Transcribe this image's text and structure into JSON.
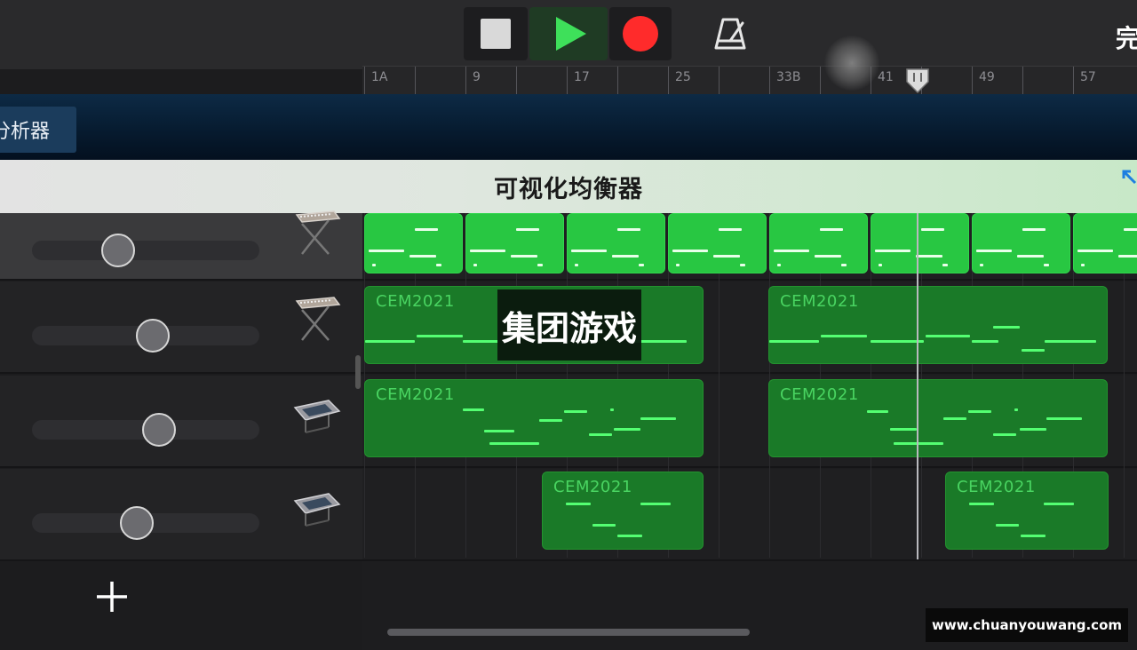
{
  "transport": {
    "stop_icon": "stop-icon",
    "play_icon": "play-icon",
    "record_icon": "record-icon",
    "metronome_icon": "metronome-icon",
    "done_label": "完成",
    "colors": {
      "play": "#3ee05a",
      "record": "#ff2b2b"
    }
  },
  "ruler": {
    "bars": [
      "1A",
      "9",
      "17",
      "25",
      "33B",
      "41",
      "49",
      "57"
    ]
  },
  "analyzer": {
    "tab_label": "分析器"
  },
  "eq": {
    "title": "可视化均衡器",
    "expand_icon": "expand-icon"
  },
  "tracks": [
    {
      "instrument_icon": "synth-keyboard-icon",
      "selected": true,
      "volume": 0.38
    },
    {
      "instrument_icon": "synth-keyboard-icon",
      "selected": false,
      "volume": 0.53
    },
    {
      "instrument_icon": "drum-machine-icon",
      "selected": false,
      "volume": 0.56
    },
    {
      "instrument_icon": "drum-machine-icon",
      "selected": false,
      "volume": 0.46
    }
  ],
  "regions": {
    "name": "CEM2021"
  },
  "add_track_icon": "plus-icon",
  "overlay": {
    "text": "集团游戏"
  },
  "watermark": {
    "text": "www.chuanyouwang.com"
  },
  "colors": {
    "region_dark": "#1a7a28",
    "region_bright": "#28c742",
    "note": "#54ff72"
  }
}
